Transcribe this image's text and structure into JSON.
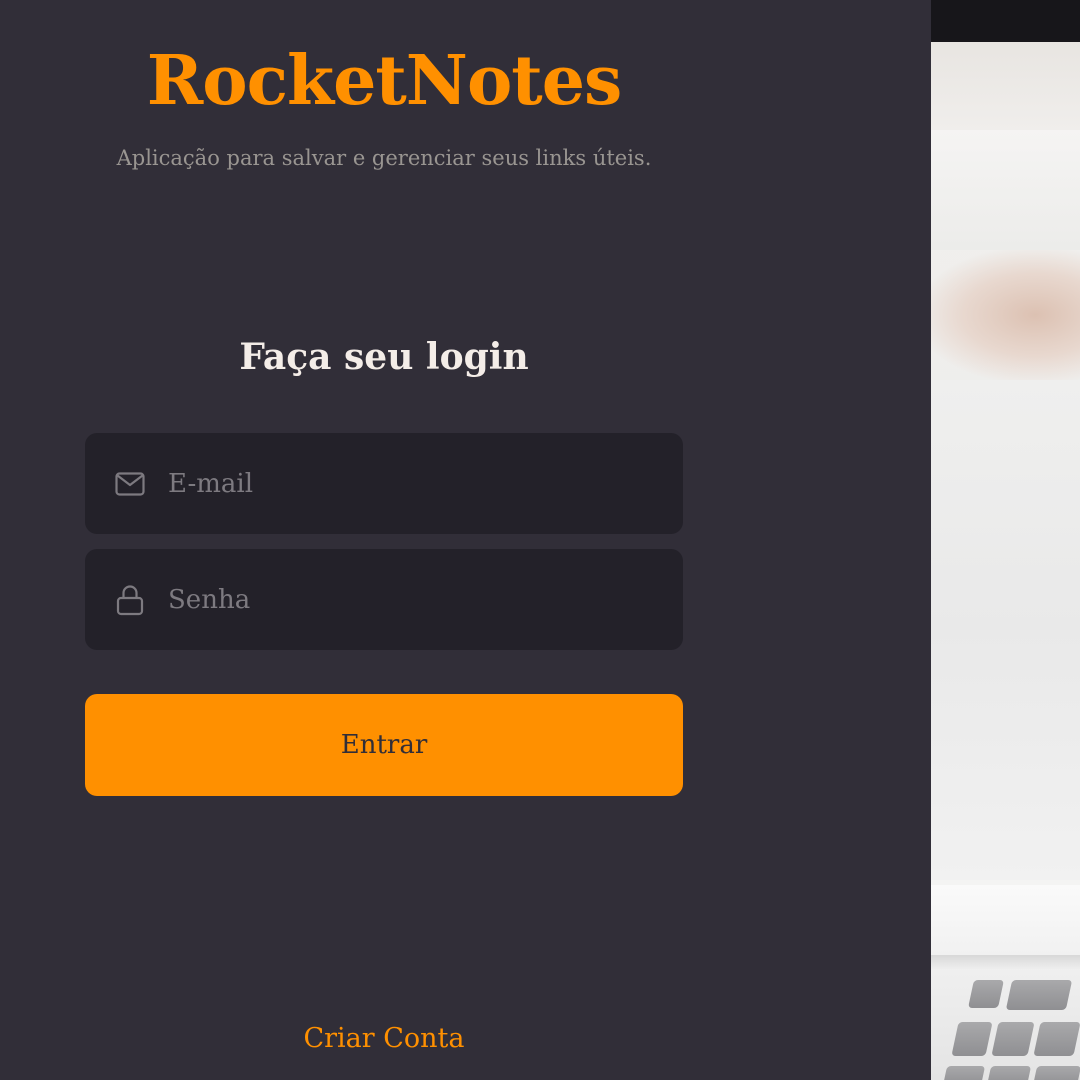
{
  "brand": {
    "title": "RocketNotes",
    "subtitle": "Aplicação para salvar e gerenciar seus links úteis."
  },
  "login": {
    "heading": "Faça seu login",
    "email": {
      "placeholder": "E-mail",
      "value": "",
      "icon": "mail-icon"
    },
    "password": {
      "placeholder": "Senha",
      "value": "",
      "icon": "lock-icon"
    },
    "submit_label": "Entrar",
    "create_account_label": "Criar Conta"
  },
  "colors": {
    "background": "#312E38",
    "input_background": "#232129",
    "accent": "#FF9000",
    "text": "#F4EDE8",
    "muted_text": "#999591",
    "placeholder": "#7D7A80"
  }
}
